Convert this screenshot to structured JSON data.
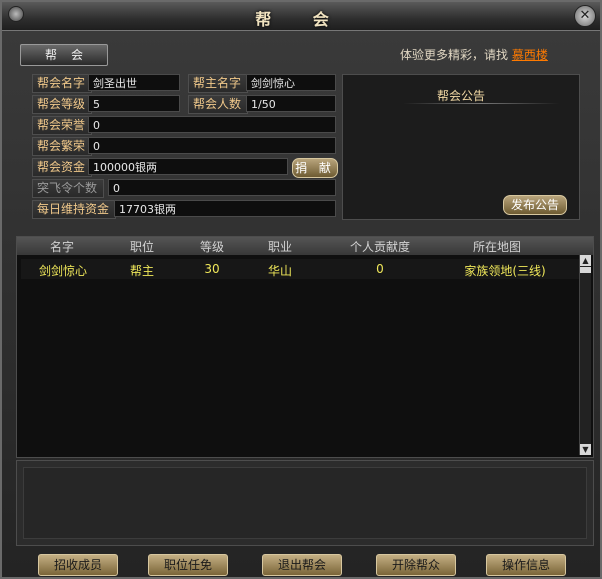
{
  "window": {
    "title": "帮 会",
    "close_symbol": "✕"
  },
  "tab": {
    "label": "帮会"
  },
  "hint": {
    "prefix": "体验更多精彩，请找",
    "link": "慕西楼"
  },
  "info": {
    "guild_name_label": "帮会名字",
    "guild_name": "剑圣出世",
    "leader_label": "帮主名字",
    "leader": "剑剑惊心",
    "level_label": "帮会等级",
    "level": "5",
    "members_label": "帮会人数",
    "members": "1/50",
    "honor_label": "帮会荣誉",
    "honor": "0",
    "prosperity_label": "帮会繁荣",
    "prosperity": "0",
    "funds_label": "帮会资金",
    "funds": "100000银两",
    "donate_label": "捐 献",
    "breakthrough_label": "突飞令个数",
    "breakthrough": "0",
    "upkeep_label": "每日维持资金",
    "upkeep": "17703银两"
  },
  "notice": {
    "title": "帮会公告",
    "publish_label": "发布公告"
  },
  "table": {
    "headers": [
      "名字",
      "职位",
      "等级",
      "职业",
      "个人贡献度",
      "所在地图"
    ],
    "rows": [
      [
        "剑剑惊心",
        "帮主",
        "30",
        "华山",
        "0",
        "家族领地(三线)"
      ]
    ]
  },
  "buttons": [
    "招收成员",
    "职位任免",
    "退出帮会",
    "开除帮众",
    "操作信息"
  ],
  "icons": {
    "scroll_up": "scroll-up-arrow-icon",
    "scroll_down": "scroll-down-arrow-icon",
    "close": "close-icon"
  }
}
